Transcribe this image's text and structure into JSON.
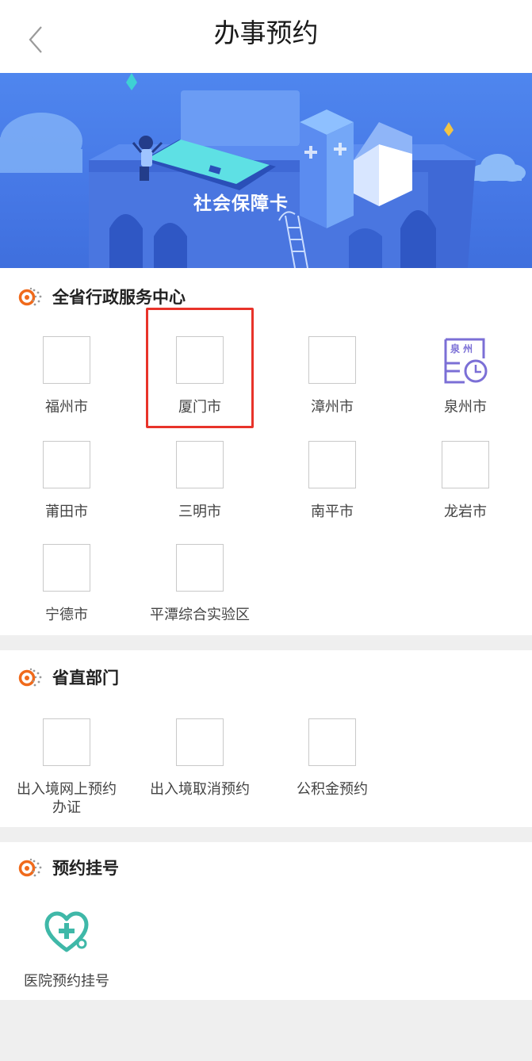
{
  "header": {
    "title": "办事预约"
  },
  "banner": {
    "title": "社会保障卡"
  },
  "sections": {
    "admin_centers": {
      "title": "全省行政服务中心",
      "items": [
        "福州市",
        "厦门市",
        "漳州市",
        "泉州市",
        "莆田市",
        "三明市",
        "南平市",
        "龙岩市",
        "宁德市",
        "平潭综合实验区"
      ],
      "quanzhou_icon_text": "泉 州"
    },
    "provincial_depts": {
      "title": "省直部门",
      "items": [
        "出入境网上预约办证",
        "出入境取消预约",
        "公积金预约"
      ]
    },
    "registration": {
      "title": "预约挂号",
      "items": [
        "医院预约挂号"
      ]
    }
  },
  "colors": {
    "accent_orange": "#f06a1b",
    "highlight_red": "#e8332a",
    "banner_blue": "#4a7fea",
    "quanzhou_icon": "#7b6fd6",
    "hospital_icon": "#3fb8a8"
  }
}
